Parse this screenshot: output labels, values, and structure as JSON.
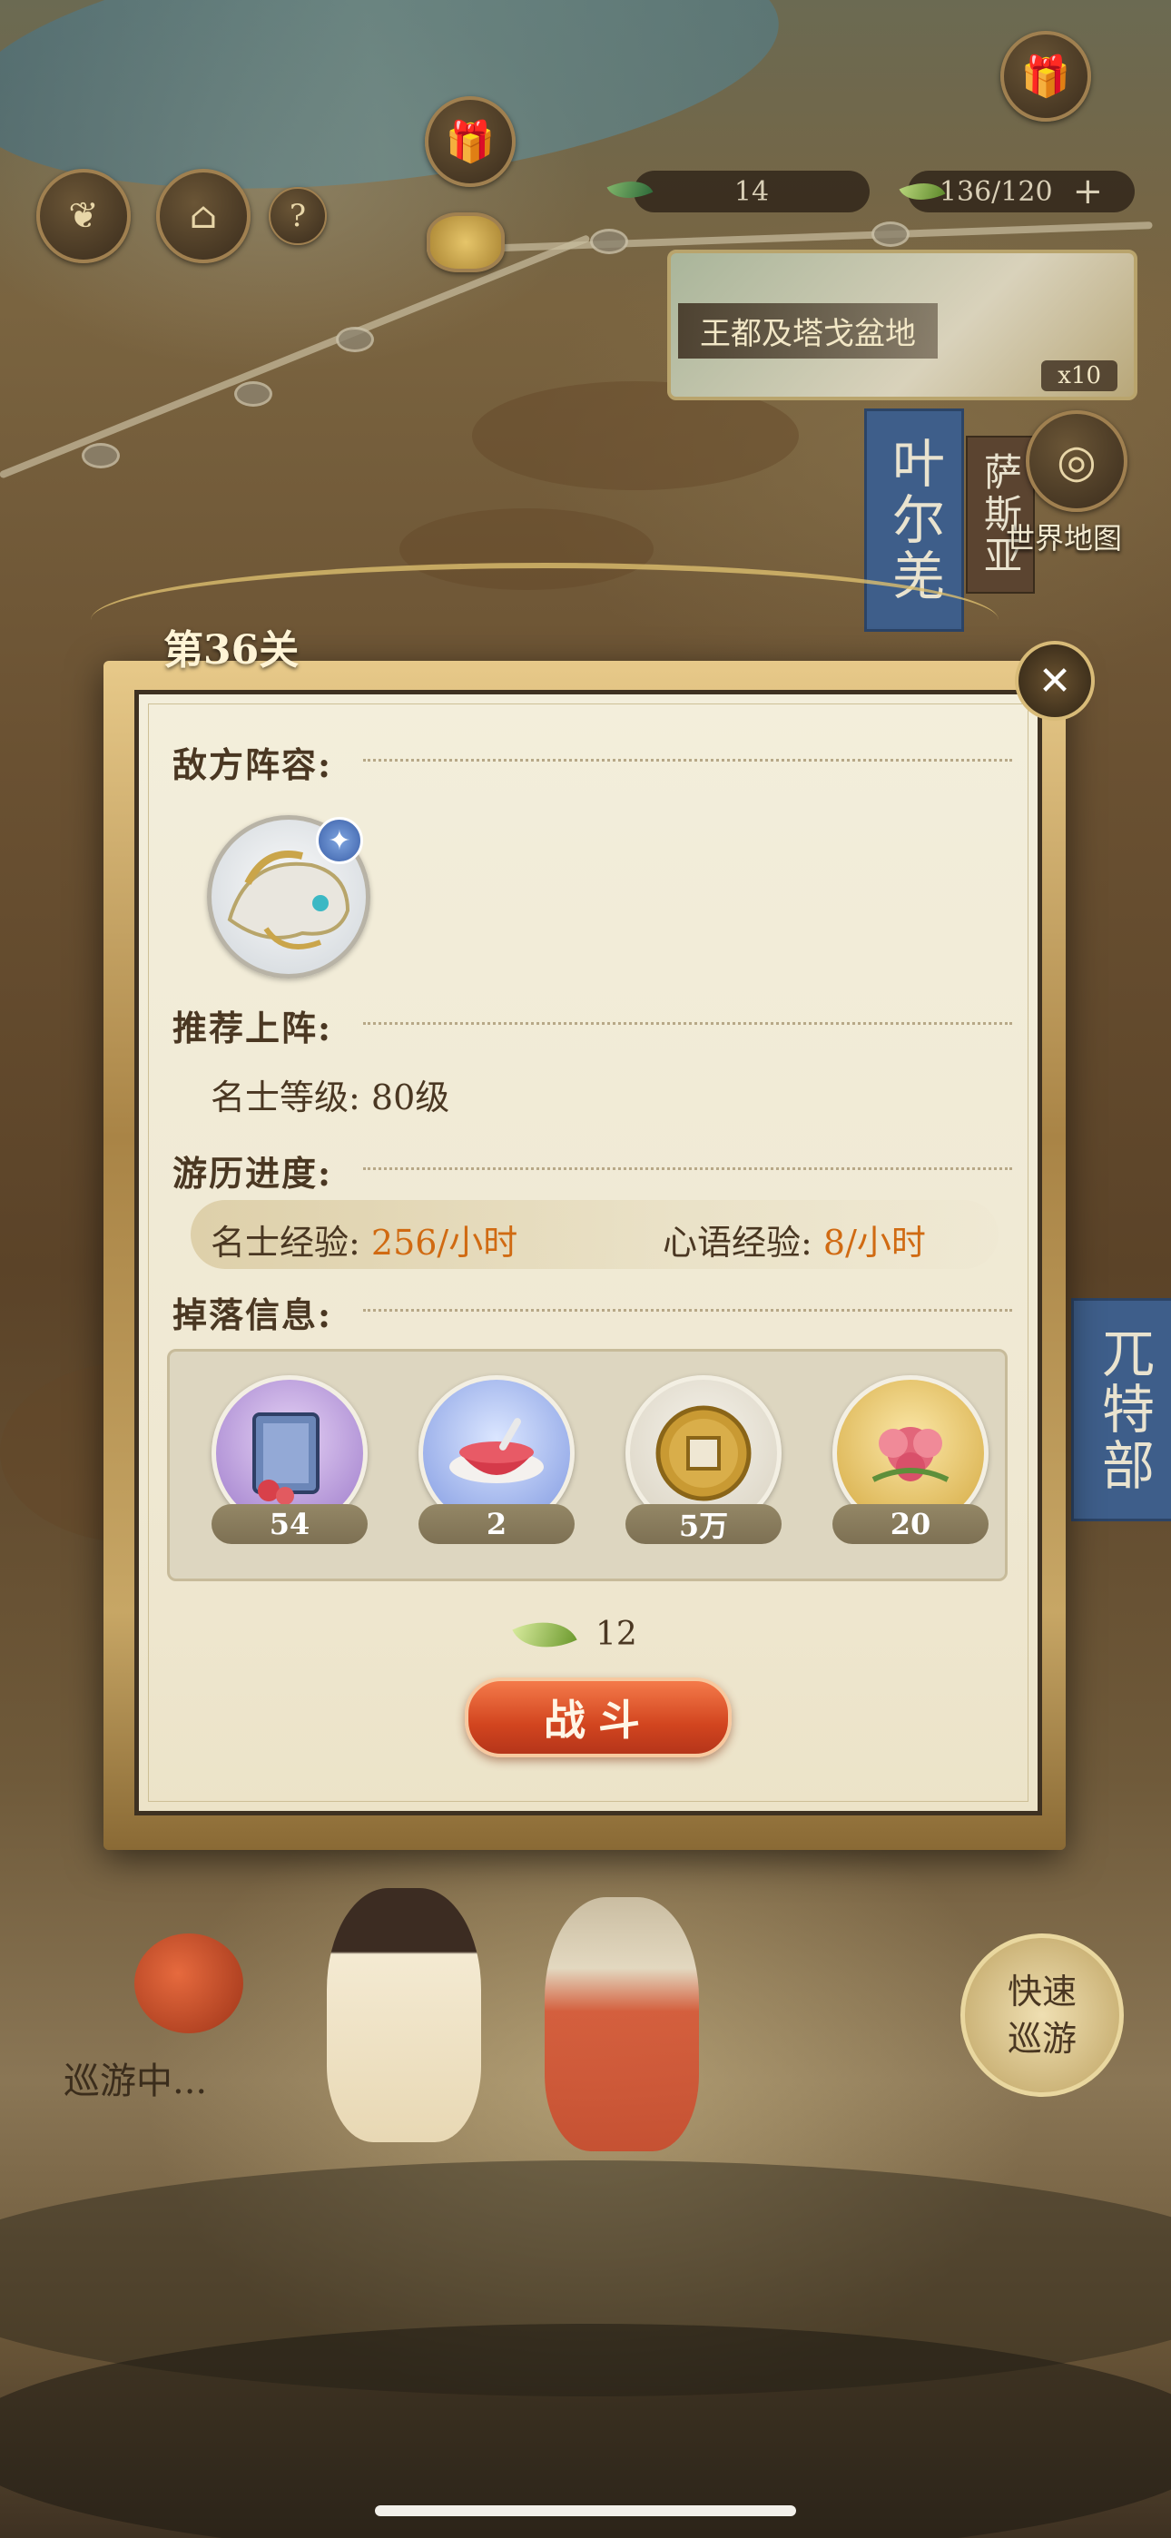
{
  "hud": {
    "green_resource": "14",
    "energy": "136/120",
    "plus": "+",
    "help": "?"
  },
  "region": {
    "name": "王都及塔戈盆地",
    "multiplier": "x10"
  },
  "map_labels": {
    "yeerqiang": "叶尔羌",
    "sasiya": "萨斯亚",
    "world_map": "世界地图",
    "wutebu": "兀特部"
  },
  "modal": {
    "stage_title": "第36关",
    "close": "✕",
    "enemy_label": "敌方阵容:",
    "recommend_label": "推荐上阵:",
    "level_label": "名士等级:",
    "level_value": "80级",
    "progress_label": "游历进度:",
    "exp_label": "名士经验:",
    "exp_value": "256/小时",
    "heart_label": "心语经验:",
    "heart_value": "8/小时",
    "drops_label": "掉落信息:",
    "drops": [
      {
        "icon": "book-icon",
        "count": "54"
      },
      {
        "icon": "dessert-bowl-icon",
        "count": "2"
      },
      {
        "icon": "coin-icon",
        "count": "5万"
      },
      {
        "icon": "peony-icon",
        "count": "20"
      }
    ],
    "cost": "12",
    "fight": "战斗"
  },
  "footer": {
    "touring": "巡游中...",
    "quick_tour": "快速巡游"
  },
  "colors": {
    "accent_orange": "#d06a12",
    "fight_red": "#d2451f",
    "panel_bg": "#efe8d2"
  }
}
